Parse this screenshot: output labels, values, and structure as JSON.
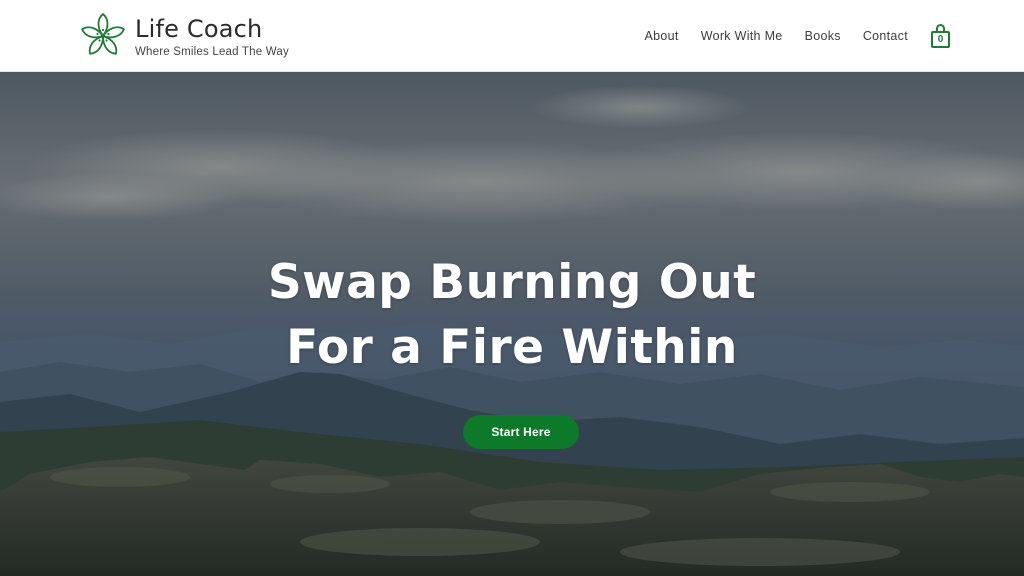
{
  "brand": {
    "title": "Life Coach",
    "tagline": "Where Smiles Lead The Way",
    "logo_icon": "flower-icon",
    "accent_color": "#1e7d32"
  },
  "nav": {
    "items": [
      {
        "label": "About"
      },
      {
        "label": "Work With Me"
      },
      {
        "label": "Books"
      },
      {
        "label": "Contact"
      }
    ],
    "cart": {
      "icon": "shopping-bag-icon",
      "count": "0"
    }
  },
  "hero": {
    "headline_line1": "Swap Burning Out",
    "headline_line2": "For a Fire Within",
    "cta_label": "Start Here",
    "cta_color": "#0d7a2a"
  }
}
